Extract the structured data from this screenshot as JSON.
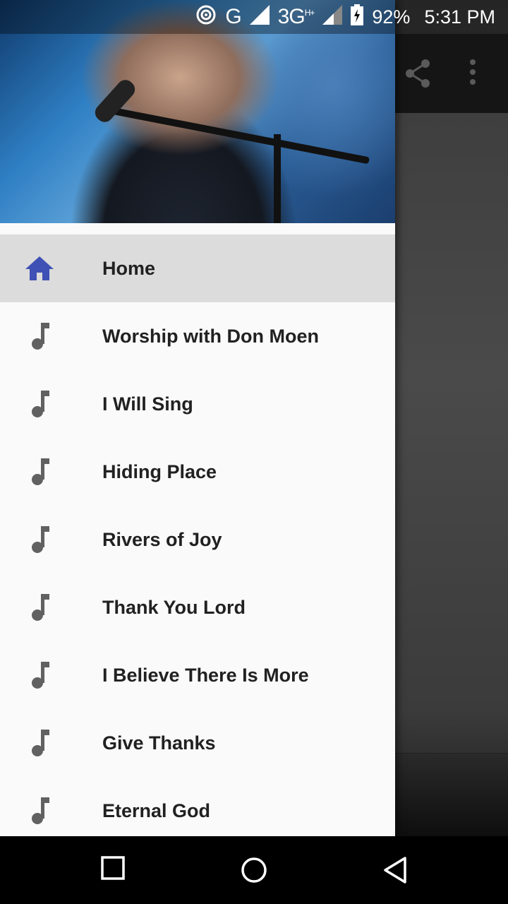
{
  "status_bar": {
    "network_g": "G",
    "network_3g": "3G",
    "network_3g_sup": "H+",
    "battery": "92%",
    "time": "5:31 PM"
  },
  "toolbar": {
    "share_icon": "share-icon",
    "more_icon": "more-vert-icon"
  },
  "drawer": {
    "header_image": "photo of singer at microphone",
    "items": [
      {
        "label": "Home",
        "icon": "home-icon",
        "active": true
      },
      {
        "label": "Worship with Don Moen",
        "icon": "music-note-icon"
      },
      {
        "label": "I Will Sing",
        "icon": "music-note-icon"
      },
      {
        "label": "Hiding Place",
        "icon": "music-note-icon"
      },
      {
        "label": "Rivers of Joy",
        "icon": "music-note-icon"
      },
      {
        "label": "Thank You Lord",
        "icon": "music-note-icon"
      },
      {
        "label": "I Believe There Is More",
        "icon": "music-note-icon"
      },
      {
        "label": "Give Thanks",
        "icon": "music-note-icon"
      },
      {
        "label": "Eternal God",
        "icon": "music-note-icon"
      }
    ]
  },
  "colors": {
    "accent": "#3f51b5",
    "icon_gray": "#616161",
    "active_bg": "#dcdcdc"
  }
}
